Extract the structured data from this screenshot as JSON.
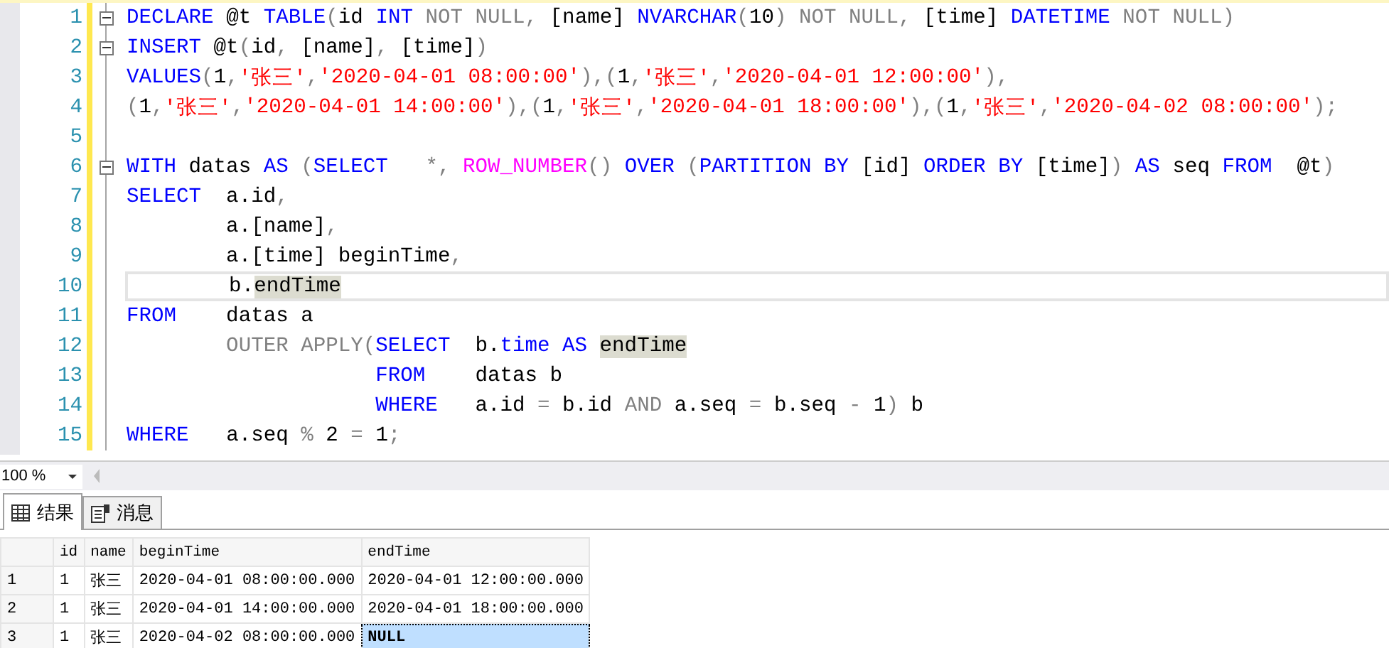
{
  "editor": {
    "lines": [
      {
        "number": "1",
        "foldable": true,
        "current": false,
        "tokens": [
          {
            "kind": "kw",
            "text": "DECLARE"
          },
          {
            "kind": "plain",
            "text": " @t "
          },
          {
            "kind": "kw",
            "text": "TABLE"
          },
          {
            "kind": "gray",
            "text": "("
          },
          {
            "kind": "plain",
            "text": "id "
          },
          {
            "kind": "kw",
            "text": "INT"
          },
          {
            "kind": "gray",
            "text": " NOT NULL,"
          },
          {
            "kind": "plain",
            "text": " [name] "
          },
          {
            "kind": "kw",
            "text": "NVARCHAR"
          },
          {
            "kind": "gray",
            "text": "("
          },
          {
            "kind": "plain",
            "text": "10"
          },
          {
            "kind": "gray",
            "text": ") NOT NULL,"
          },
          {
            "kind": "plain",
            "text": " [time] "
          },
          {
            "kind": "kw",
            "text": "DATETIME"
          },
          {
            "kind": "gray",
            "text": " NOT NULL)"
          }
        ]
      },
      {
        "number": "2",
        "foldable": true,
        "current": false,
        "tokens": [
          {
            "kind": "kw",
            "text": "INSERT"
          },
          {
            "kind": "plain",
            "text": " @t"
          },
          {
            "kind": "gray",
            "text": "("
          },
          {
            "kind": "plain",
            "text": "id"
          },
          {
            "kind": "gray",
            "text": ","
          },
          {
            "kind": "plain",
            "text": " [name]"
          },
          {
            "kind": "gray",
            "text": ","
          },
          {
            "kind": "plain",
            "text": " [time]"
          },
          {
            "kind": "gray",
            "text": ")"
          }
        ]
      },
      {
        "number": "3",
        "foldable": false,
        "current": false,
        "tokens": [
          {
            "kind": "kw",
            "text": "VALUES"
          },
          {
            "kind": "gray",
            "text": "("
          },
          {
            "kind": "plain",
            "text": "1"
          },
          {
            "kind": "gray",
            "text": ","
          },
          {
            "kind": "str",
            "text": "'张三'"
          },
          {
            "kind": "gray",
            "text": ","
          },
          {
            "kind": "str",
            "text": "'2020-04-01 08:00:00'"
          },
          {
            "kind": "gray",
            "text": "),("
          },
          {
            "kind": "plain",
            "text": "1"
          },
          {
            "kind": "gray",
            "text": ","
          },
          {
            "kind": "str",
            "text": "'张三'"
          },
          {
            "kind": "gray",
            "text": ","
          },
          {
            "kind": "str",
            "text": "'2020-04-01 12:00:00'"
          },
          {
            "kind": "gray",
            "text": "),"
          }
        ]
      },
      {
        "number": "4",
        "foldable": false,
        "current": false,
        "tokens": [
          {
            "kind": "gray",
            "text": "("
          },
          {
            "kind": "plain",
            "text": "1"
          },
          {
            "kind": "gray",
            "text": ","
          },
          {
            "kind": "str",
            "text": "'张三'"
          },
          {
            "kind": "gray",
            "text": ","
          },
          {
            "kind": "str",
            "text": "'2020-04-01 14:00:00'"
          },
          {
            "kind": "gray",
            "text": "),("
          },
          {
            "kind": "plain",
            "text": "1"
          },
          {
            "kind": "gray",
            "text": ","
          },
          {
            "kind": "str",
            "text": "'张三'"
          },
          {
            "kind": "gray",
            "text": ","
          },
          {
            "kind": "str",
            "text": "'2020-04-01 18:00:00'"
          },
          {
            "kind": "gray",
            "text": "),("
          },
          {
            "kind": "plain",
            "text": "1"
          },
          {
            "kind": "gray",
            "text": ","
          },
          {
            "kind": "str",
            "text": "'张三'"
          },
          {
            "kind": "gray",
            "text": ","
          },
          {
            "kind": "str",
            "text": "'2020-04-02 08:00:00'"
          },
          {
            "kind": "gray",
            "text": ");"
          }
        ]
      },
      {
        "number": "5",
        "foldable": false,
        "current": false
      },
      {
        "number": "6",
        "foldable": true,
        "current": false,
        "tokens": [
          {
            "kind": "kw",
            "text": "WITH"
          },
          {
            "kind": "plain",
            "text": " datas "
          },
          {
            "kind": "kw",
            "text": "AS"
          },
          {
            "kind": "gray",
            "text": " ("
          },
          {
            "kind": "kw",
            "text": "SELECT"
          },
          {
            "kind": "gray",
            "text": "   *,"
          },
          {
            "kind": "fn",
            "text": " ROW_NUMBER"
          },
          {
            "kind": "gray",
            "text": "()"
          },
          {
            "kind": "kw",
            "text": " OVER"
          },
          {
            "kind": "gray",
            "text": " ("
          },
          {
            "kind": "kw",
            "text": "PARTITION BY"
          },
          {
            "kind": "plain",
            "text": " [id] "
          },
          {
            "kind": "kw",
            "text": "ORDER BY"
          },
          {
            "kind": "plain",
            "text": " [time]"
          },
          {
            "kind": "gray",
            "text": ")"
          },
          {
            "kind": "kw",
            "text": " AS"
          },
          {
            "kind": "plain",
            "text": " seq "
          },
          {
            "kind": "kw",
            "text": "FROM"
          },
          {
            "kind": "plain",
            "text": "  @t"
          },
          {
            "kind": "gray",
            "text": ")"
          }
        ]
      },
      {
        "number": "7",
        "foldable": false,
        "current": false,
        "tokens": [
          {
            "kind": "kw",
            "text": "SELECT"
          },
          {
            "kind": "plain",
            "text": "  a.id"
          },
          {
            "kind": "gray",
            "text": ","
          }
        ]
      },
      {
        "number": "8",
        "foldable": false,
        "current": false,
        "tokens": [
          {
            "kind": "plain",
            "text": "        a.[name]"
          },
          {
            "kind": "gray",
            "text": ","
          }
        ]
      },
      {
        "number": "9",
        "foldable": false,
        "current": false,
        "tokens": [
          {
            "kind": "plain",
            "text": "        a.[time] beginTime"
          },
          {
            "kind": "gray",
            "text": ","
          }
        ]
      },
      {
        "number": "10",
        "foldable": false,
        "current": true,
        "tokens": [
          {
            "kind": "plain",
            "text": "        b."
          },
          {
            "kind": "hl",
            "text": "endTime"
          }
        ]
      },
      {
        "number": "11",
        "foldable": false,
        "current": false,
        "tokens": [
          {
            "kind": "kw",
            "text": "FROM"
          },
          {
            "kind": "plain",
            "text": "    datas a"
          }
        ]
      },
      {
        "number": "12",
        "foldable": false,
        "current": false,
        "tokens": [
          {
            "kind": "gray",
            "text": "        OUTER APPLY("
          },
          {
            "kind": "kw",
            "text": "SELECT"
          },
          {
            "kind": "plain",
            "text": "  b."
          },
          {
            "kind": "kw",
            "text": "time AS "
          },
          {
            "kind": "hl",
            "text": "endTime"
          }
        ]
      },
      {
        "number": "13",
        "foldable": false,
        "current": false,
        "tokens": [
          {
            "kind": "kw",
            "text": "                    FROM"
          },
          {
            "kind": "plain",
            "text": "    datas b"
          }
        ]
      },
      {
        "number": "14",
        "foldable": false,
        "current": false,
        "tokens": [
          {
            "kind": "kw",
            "text": "                    WHERE"
          },
          {
            "kind": "plain",
            "text": "   a.id "
          },
          {
            "kind": "gray",
            "text": "="
          },
          {
            "kind": "plain",
            "text": " b.id "
          },
          {
            "kind": "gray",
            "text": "AND"
          },
          {
            "kind": "plain",
            "text": " a.seq "
          },
          {
            "kind": "gray",
            "text": "="
          },
          {
            "kind": "plain",
            "text": " b.seq "
          },
          {
            "kind": "gray",
            "text": "-"
          },
          {
            "kind": "plain",
            "text": " 1"
          },
          {
            "kind": "gray",
            "text": ")"
          },
          {
            "kind": "plain",
            "text": " b"
          }
        ]
      },
      {
        "number": "15",
        "foldable": false,
        "current": false,
        "tokens": [
          {
            "kind": "kw",
            "text": "WHERE"
          },
          {
            "kind": "plain",
            "text": "   a.seq "
          },
          {
            "kind": "gray",
            "text": "%"
          },
          {
            "kind": "plain",
            "text": " 2 "
          },
          {
            "kind": "gray",
            "text": "="
          },
          {
            "kind": "plain",
            "text": " 1"
          },
          {
            "kind": "gray",
            "text": ";"
          }
        ]
      }
    ]
  },
  "zoom": {
    "value": "100 %"
  },
  "tabs": [
    {
      "label": "结果",
      "selected": true
    },
    {
      "label": "消息",
      "selected": false
    }
  ],
  "results": {
    "columns": [
      "id",
      "name",
      "beginTime",
      "endTime"
    ],
    "rows": [
      {
        "number": "1",
        "cells": [
          {
            "text": "1",
            "selected": false
          },
          {
            "text": "张三",
            "selected": false
          },
          {
            "text": "2020-04-01 08:00:00.000",
            "selected": false
          },
          {
            "text": "2020-04-01 12:00:00.000",
            "selected": false
          }
        ]
      },
      {
        "number": "2",
        "cells": [
          {
            "text": "1",
            "selected": false
          },
          {
            "text": "张三",
            "selected": false
          },
          {
            "text": "2020-04-01 14:00:00.000",
            "selected": false
          },
          {
            "text": "2020-04-01 18:00:00.000",
            "selected": false
          }
        ]
      },
      {
        "number": "3",
        "cells": [
          {
            "text": "1",
            "selected": false
          },
          {
            "text": "张三",
            "selected": false
          },
          {
            "text": "2020-04-02 08:00:00.000",
            "selected": false
          },
          {
            "text": "NULL",
            "selected": true
          }
        ]
      }
    ]
  }
}
